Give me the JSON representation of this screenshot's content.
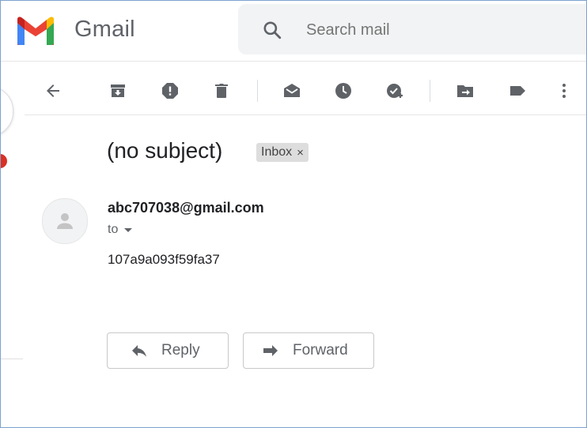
{
  "app": {
    "name": "Gmail"
  },
  "search": {
    "placeholder": "Search mail",
    "value": ""
  },
  "icons": {
    "logo": "gmail-logo",
    "search": "search-icon",
    "toolbar": [
      "back-arrow-icon",
      "archive-icon",
      "report-spam-icon",
      "delete-icon",
      "mark-unread-icon",
      "snooze-icon",
      "add-task-icon",
      "move-to-icon",
      "label-icon",
      "more-vert-icon"
    ],
    "avatar": "person-icon",
    "reply": "reply-arrow-icon",
    "forward": "forward-arrow-icon"
  },
  "colors": {
    "brand_red": "#ea4335",
    "brand_blue": "#4285f4",
    "brand_green": "#34a853",
    "brand_yellow": "#fbbc04",
    "icon_gray": "#5f6368",
    "search_bg": "#f1f3f4",
    "label_chip_bg": "#dddddd"
  },
  "message": {
    "subject": "(no subject)",
    "label": "Inbox",
    "label_remove": "×",
    "sender": "abc707038@gmail.com",
    "recipient": "to",
    "body": "107a9a093f59fa37"
  },
  "actions": {
    "reply": "Reply",
    "forward": "Forward"
  }
}
